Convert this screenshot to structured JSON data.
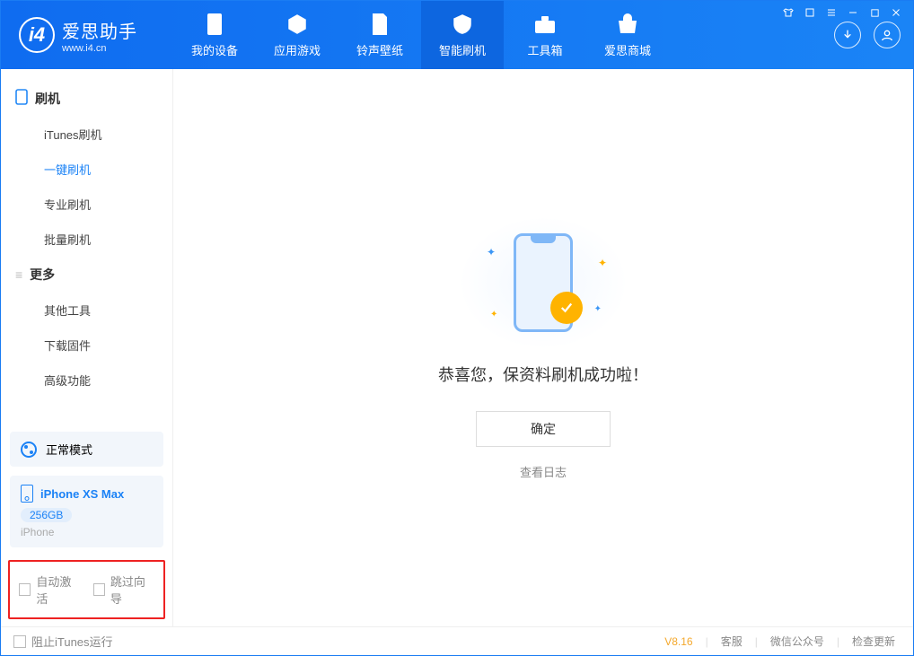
{
  "app": {
    "name": "爱思助手",
    "url": "www.i4.cn"
  },
  "tabs": [
    {
      "label": "我的设备"
    },
    {
      "label": "应用游戏"
    },
    {
      "label": "铃声壁纸"
    },
    {
      "label": "智能刷机"
    },
    {
      "label": "工具箱"
    },
    {
      "label": "爱思商城"
    }
  ],
  "sidebar": {
    "section1": {
      "title": "刷机",
      "items": [
        "iTunes刷机",
        "一键刷机",
        "专业刷机",
        "批量刷机"
      ],
      "active_index": 1
    },
    "section2": {
      "title": "更多",
      "items": [
        "其他工具",
        "下载固件",
        "高级功能"
      ]
    },
    "mode": "正常模式",
    "device": {
      "name": "iPhone XS Max",
      "capacity": "256GB",
      "type": "iPhone"
    },
    "opts": {
      "auto_activate": "自动激活",
      "skip_guide": "跳过向导"
    }
  },
  "main": {
    "title": "恭喜您，保资料刷机成功啦！",
    "confirm": "确定",
    "view_log": "查看日志"
  },
  "status": {
    "block_itunes": "阻止iTunes运行",
    "version": "V8.16",
    "links": [
      "客服",
      "微信公众号",
      "检查更新"
    ]
  }
}
